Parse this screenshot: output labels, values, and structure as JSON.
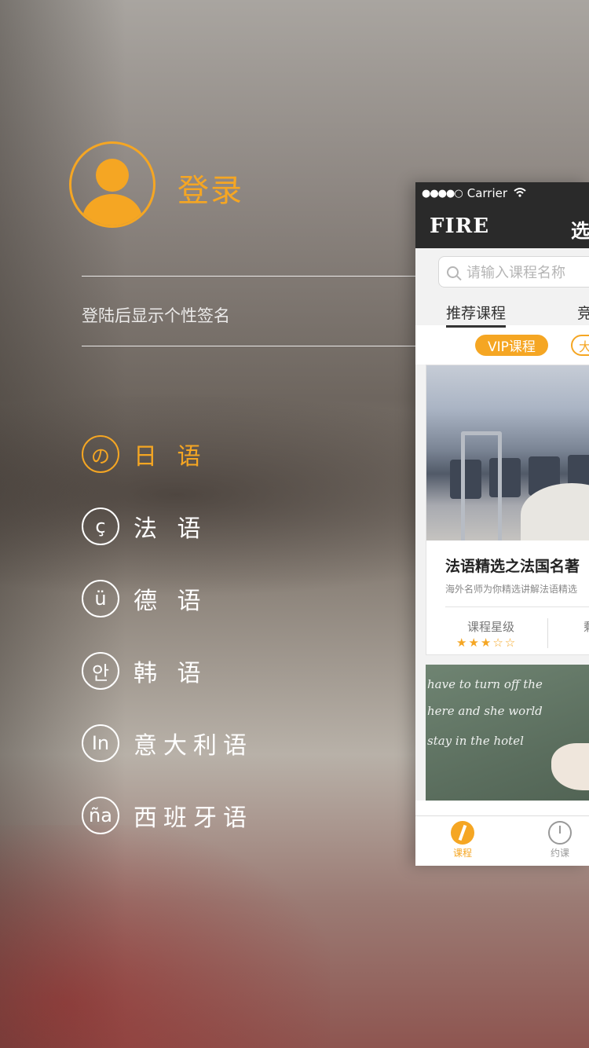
{
  "colors": {
    "accent": "#f5a623",
    "nav_bar": "#2a2a2a",
    "menu_text": "#ffffff"
  },
  "profile": {
    "login_label": "登录",
    "signature_placeholder": "登陆后显示个性签名",
    "avatar_icon": "user-silhouette-icon"
  },
  "languages": [
    {
      "badge": "の",
      "label": "日 语",
      "active": true
    },
    {
      "badge": "ç",
      "label": "法 语",
      "active": false
    },
    {
      "badge": "ü",
      "label": "德 语",
      "active": false
    },
    {
      "badge": "안",
      "label": "韩 语",
      "active": false
    },
    {
      "badge": "In",
      "label": "意大利语",
      "active": false
    },
    {
      "badge": "ña",
      "label": "西班牙语",
      "active": false
    }
  ],
  "preview": {
    "status": {
      "signal": "●●●●○",
      "carrier": "Carrier",
      "wifi_icon": "wifi-icon"
    },
    "nav": {
      "brand": "FIRE",
      "right_label": "选"
    },
    "search": {
      "placeholder": "请输入课程名称"
    },
    "tabs": {
      "main": "推荐课程",
      "more": "竞"
    },
    "chips": {
      "vip": "VIP课程",
      "next": "大"
    },
    "course": {
      "title": "法语精选之法国名著",
      "desc": "海外名师为你精选讲解法语精选",
      "rating_label": "课程星级",
      "stars": "★★★☆☆",
      "right_label": "剩"
    },
    "chalkboard": [
      "have to  turn off the",
      "here  and  she world",
      "stay in the hotel"
    ],
    "tabbar": [
      {
        "label": "课程",
        "icon": "compass-icon",
        "active": true
      },
      {
        "label": "约课",
        "icon": "alarm-clock-icon",
        "active": false
      }
    ]
  }
}
